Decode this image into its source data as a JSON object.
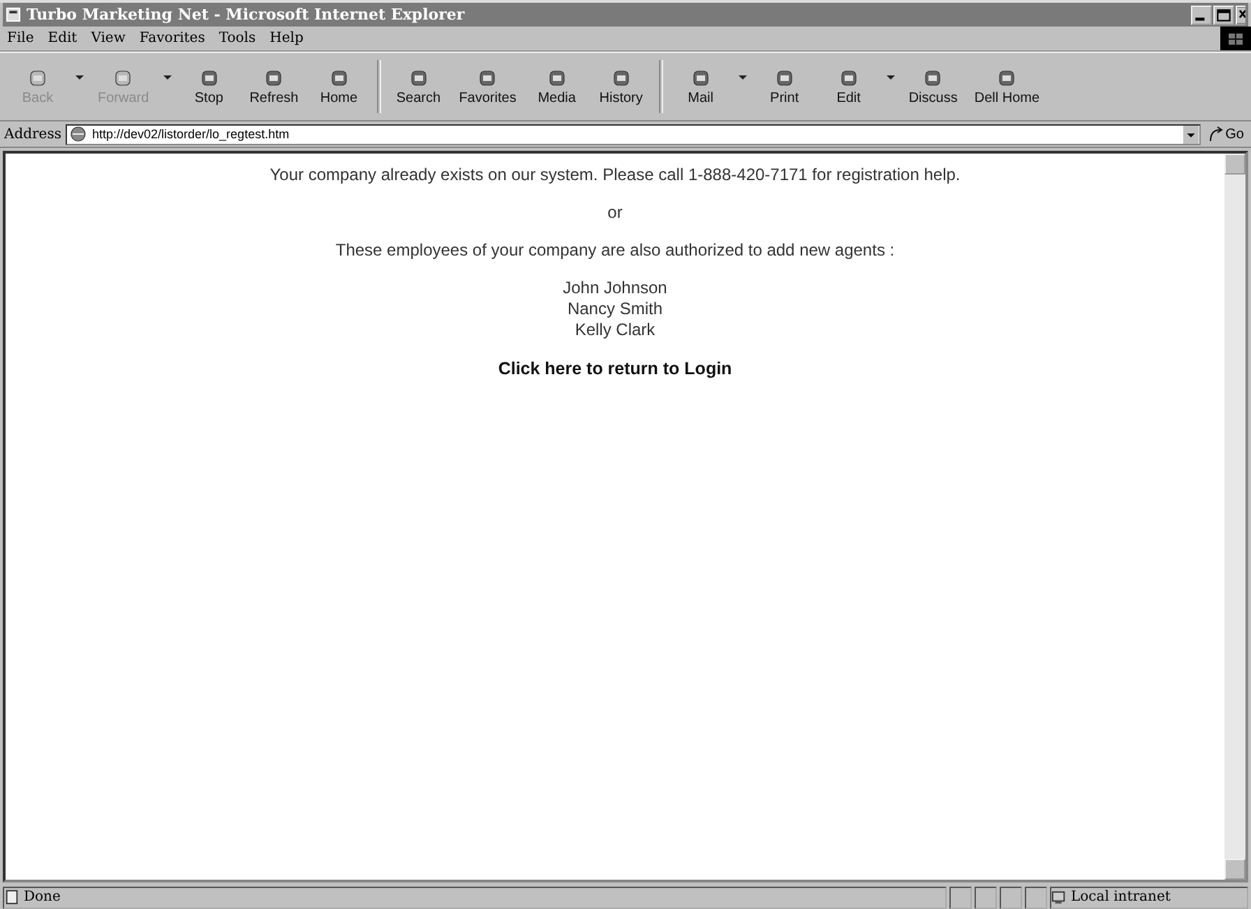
{
  "window": {
    "title": "Turbo Marketing Net - Microsoft Internet Explorer"
  },
  "menu": [
    "File",
    "Edit",
    "View",
    "Favorites",
    "Tools",
    "Help"
  ],
  "toolbar": {
    "groups": [
      [
        {
          "label": "Back",
          "disabled": true,
          "dropdown": true
        },
        {
          "label": "Forward",
          "disabled": true,
          "dropdown": true
        },
        {
          "label": "Stop",
          "disabled": false,
          "dropdown": false
        },
        {
          "label": "Refresh",
          "disabled": false,
          "dropdown": false
        },
        {
          "label": "Home",
          "disabled": false,
          "dropdown": false
        }
      ],
      [
        {
          "label": "Search",
          "disabled": false,
          "dropdown": false
        },
        {
          "label": "Favorites",
          "disabled": false,
          "dropdown": false
        },
        {
          "label": "Media",
          "disabled": false,
          "dropdown": false
        },
        {
          "label": "History",
          "disabled": false,
          "dropdown": false
        }
      ],
      [
        {
          "label": "Mail",
          "disabled": false,
          "dropdown": true
        },
        {
          "label": "Print",
          "disabled": false,
          "dropdown": false
        },
        {
          "label": "Edit",
          "disabled": false,
          "dropdown": true
        },
        {
          "label": "Discuss",
          "disabled": false,
          "dropdown": false
        },
        {
          "label": "Dell Home",
          "disabled": false,
          "dropdown": false
        }
      ]
    ]
  },
  "address": {
    "label": "Address",
    "value": "http://dev02/listorder/lo_regtest.htm",
    "go": "Go"
  },
  "page": {
    "message": "Your company already exists on our system. Please call 1-888-420-7171 for registration help.",
    "or": "or",
    "employees_intro": "These employees of your company are also authorized to add new agents :",
    "employees": [
      "John Johnson",
      "Nancy Smith",
      "Kelly Clark"
    ],
    "login_link": "Click here to return to Login"
  },
  "status_bar": {
    "text": "Done",
    "zone": "Local intranet"
  }
}
